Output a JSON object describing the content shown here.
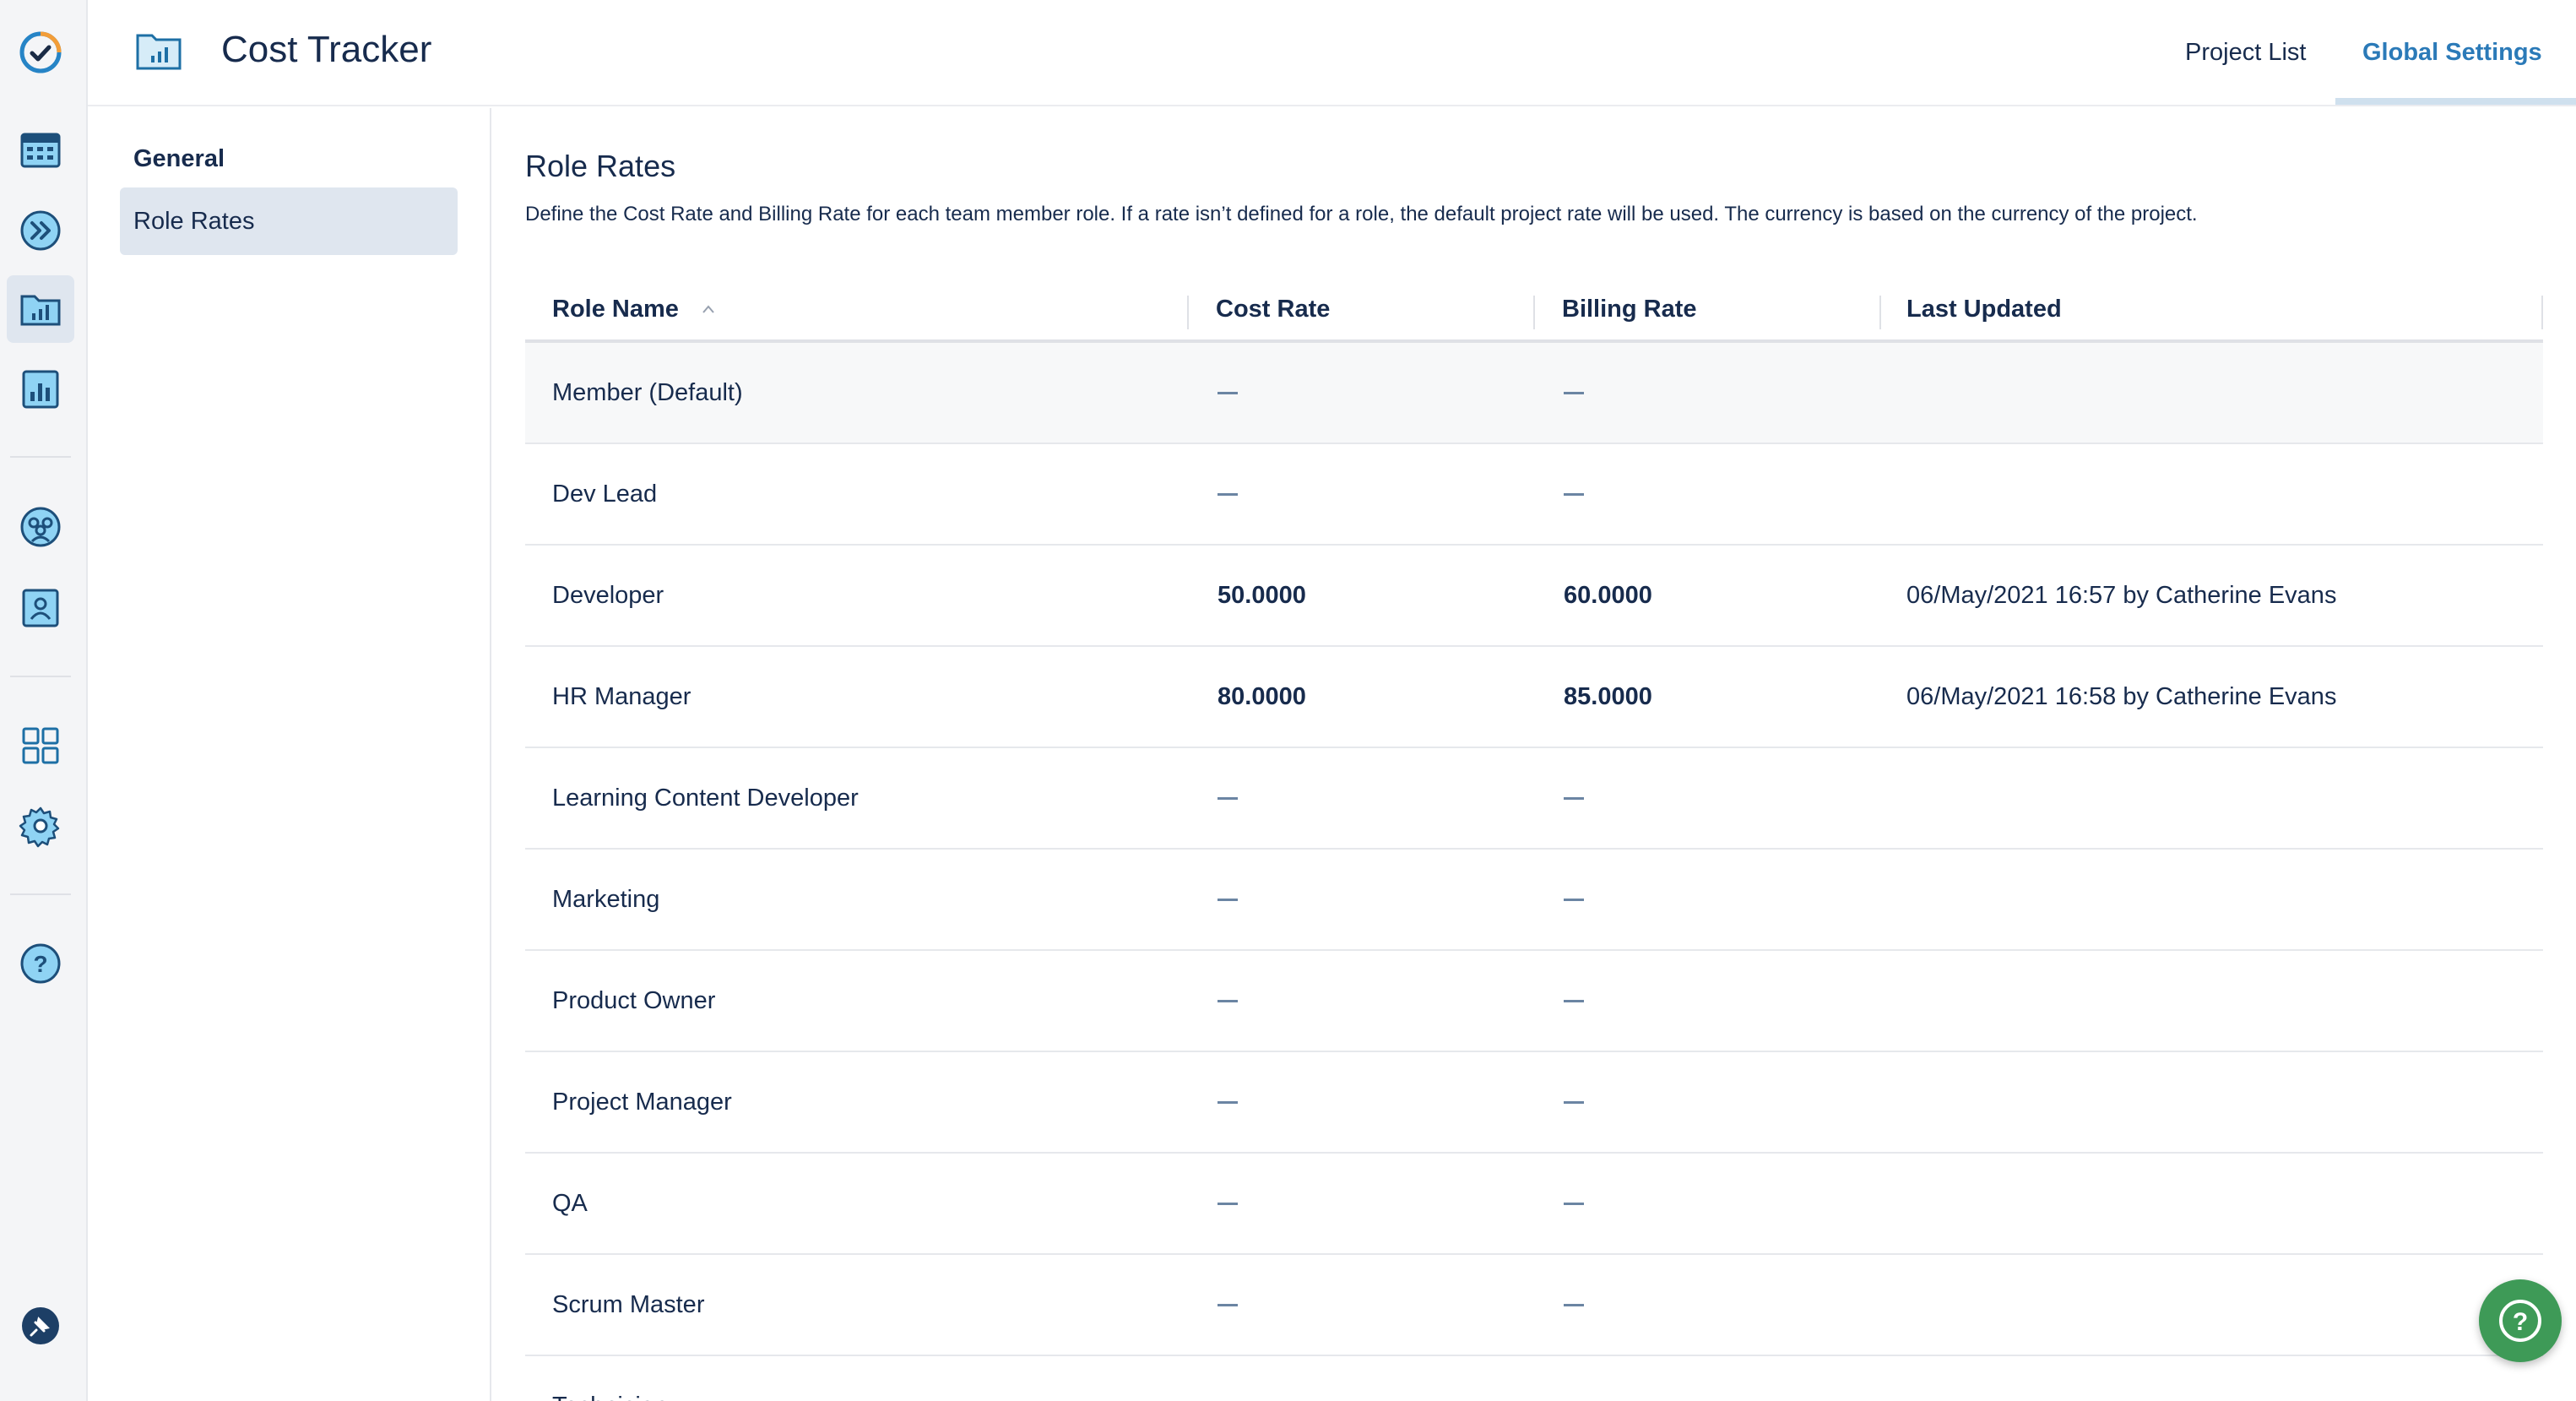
{
  "colors": {
    "accent": "#2b7ab8",
    "rail_icon": "#1d6fa5",
    "rail_icon_fill": "#8fd3f4",
    "fab": "#3e9a57",
    "dash": "#6b85a3"
  },
  "rail": {
    "items": [
      {
        "icon": "app-logo-check-icon"
      },
      {
        "icon": "calendar-icon"
      },
      {
        "icon": "double-chevron-icon"
      },
      {
        "icon": "folder-chart-icon",
        "active": true
      },
      {
        "icon": "report-chart-icon"
      },
      {
        "icon": "team-icon"
      },
      {
        "icon": "user-card-icon"
      },
      {
        "icon": "apps-grid-icon"
      },
      {
        "icon": "settings-gear-icon"
      },
      {
        "icon": "help-icon"
      },
      {
        "icon": "pin-icon"
      }
    ]
  },
  "header": {
    "title": "Cost Tracker",
    "icon": "folder-chart-icon",
    "tabs": [
      {
        "label": "Project List",
        "active": false
      },
      {
        "label": "Global Settings",
        "active": true
      }
    ]
  },
  "nav": {
    "heading": "General",
    "items": [
      {
        "label": "Role Rates",
        "active": true
      }
    ]
  },
  "main": {
    "title": "Role Rates",
    "description": "Define the Cost Rate and Billing Rate for each team member role. If a rate isn’t defined for a role, the default project rate will be used. The currency is based on the currency of the project."
  },
  "table": {
    "columns": [
      "Role Name",
      "Cost Rate",
      "Billing Rate",
      "Last Updated"
    ],
    "sorted_by": "Role Name",
    "rows": [
      {
        "role": "Member (Default)",
        "cost": "",
        "billing": "",
        "updated": ""
      },
      {
        "role": "Dev Lead",
        "cost": "",
        "billing": "",
        "updated": ""
      },
      {
        "role": "Developer",
        "cost": "50.0000",
        "billing": "60.0000",
        "updated": "06/May/2021 16:57 by Catherine Evans"
      },
      {
        "role": "HR Manager",
        "cost": "80.0000",
        "billing": "85.0000",
        "updated": "06/May/2021 16:58 by Catherine Evans"
      },
      {
        "role": "Learning Content Developer",
        "cost": "",
        "billing": "",
        "updated": ""
      },
      {
        "role": "Marketing",
        "cost": "",
        "billing": "",
        "updated": ""
      },
      {
        "role": "Product Owner",
        "cost": "",
        "billing": "",
        "updated": ""
      },
      {
        "role": "Project Manager",
        "cost": "",
        "billing": "",
        "updated": ""
      },
      {
        "role": "QA",
        "cost": "",
        "billing": "",
        "updated": ""
      },
      {
        "role": "Scrum Master",
        "cost": "",
        "billing": "",
        "updated": ""
      },
      {
        "role": "Technician",
        "cost": "",
        "billing": "",
        "updated": ""
      }
    ]
  },
  "fab": {
    "icon": "help-icon"
  }
}
